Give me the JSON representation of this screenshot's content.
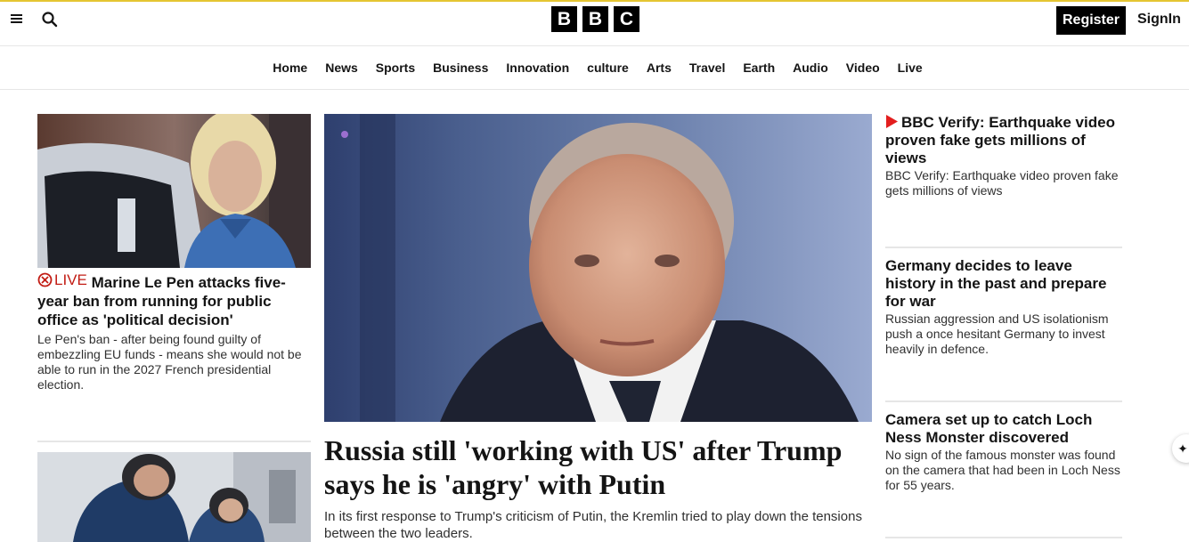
{
  "header": {
    "logo_letters": [
      "B",
      "B",
      "C"
    ],
    "register_label": "Register",
    "signin_label": "SignIn"
  },
  "nav": {
    "items": [
      "Home",
      "News",
      "Sports",
      "Business",
      "Innovation",
      "culture",
      "Arts",
      "Travel",
      "Earth",
      "Audio",
      "Video",
      "Live"
    ]
  },
  "left_stories": [
    {
      "live_label": "LIVE",
      "headline": "Marine Le Pen attacks five-year ban from running for public office as 'political decision'",
      "summary": "Le Pen's ban - after being found guilty of embezzling EU funds - means she would not be able to run in the 2027 French presidential election."
    }
  ],
  "hero": {
    "headline": "Russia still 'working with US' after Trump says he is 'angry' with Putin",
    "summary": "In its first response to Trump's criticism of Putin, the Kremlin tried to play down the tensions between the two leaders."
  },
  "right_stories": [
    {
      "headline": "BBC Verify: Earthquake video proven fake gets millions of views",
      "summary": "BBC Verify: Earthquake video proven fake gets millions of views"
    },
    {
      "headline": "Germany decides to leave history in the past and prepare for war",
      "summary": "Russian aggression and US isolationism push a once hesitant Germany to invest heavily in defence."
    },
    {
      "headline": "Camera set up to catch Loch Ness Monster discovered",
      "summary": "No sign of the famous monster was found on the camera that had been in Loch Ness for 55 years."
    }
  ],
  "colors": {
    "accent_line": "#e5c532",
    "live_red": "#c21c14",
    "play_red": "#e31e1e"
  },
  "icons": {
    "menu": "hamburger-icon",
    "search": "search-icon",
    "live": "live-icon",
    "play": "play-icon",
    "sparkle": "sparkle-icon"
  }
}
